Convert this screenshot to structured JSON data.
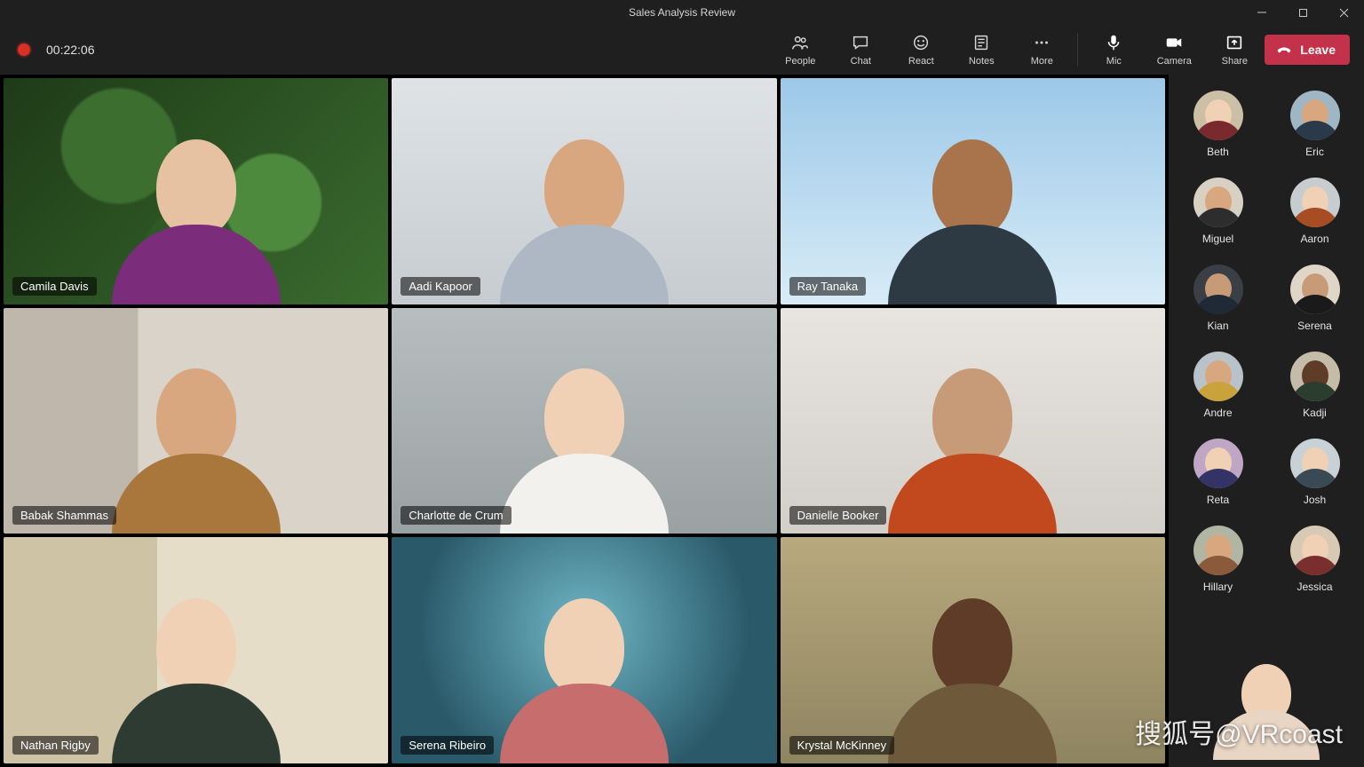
{
  "window": {
    "title": "Sales Analysis Review"
  },
  "recording": {
    "time": "00:22:06"
  },
  "toolbar": {
    "people": "People",
    "chat": "Chat",
    "react": "React",
    "notes": "Notes",
    "more": "More",
    "mic": "Mic",
    "camera": "Camera",
    "share": "Share",
    "leave": "Leave"
  },
  "participants_main": [
    {
      "name": "Camila Davis",
      "env": "env-leaves",
      "skin": "skin-1",
      "shirt": "#7b2c7a"
    },
    {
      "name": "Aadi Kapoor",
      "env": "env-office1",
      "skin": "skin-2",
      "shirt": "#aeb7c4"
    },
    {
      "name": "Ray Tanaka",
      "env": "env-sky",
      "skin": "skin-3",
      "shirt": "#2d3a44"
    },
    {
      "name": "Babak Shammas",
      "env": "env-office2",
      "skin": "skin-2",
      "shirt": "#a9773c"
    },
    {
      "name": "Charlotte de Crum",
      "env": "env-grey",
      "skin": "skin-6",
      "shirt": "#f3f1ed"
    },
    {
      "name": "Danielle Booker",
      "env": "env-plain",
      "skin": "skin-4",
      "shirt": "#c2491e"
    },
    {
      "name": "Nathan Rigby",
      "env": "env-office3",
      "skin": "skin-6",
      "shirt": "#2e3b33"
    },
    {
      "name": "Serena Ribeiro",
      "env": "env-tech",
      "skin": "skin-6",
      "shirt": "#c76d6e"
    },
    {
      "name": "Krystal McKinney",
      "env": "env-plants",
      "skin": "skin-5",
      "shirt": "#6e5a3a"
    }
  ],
  "participants_side": [
    {
      "name": "Beth",
      "bg": "#cbbfa5",
      "skin": "skin-6",
      "shirt": "#7a2a2d"
    },
    {
      "name": "Eric",
      "bg": "#9fb7c4",
      "skin": "skin-2",
      "shirt": "#2a3a4a"
    },
    {
      "name": "Miguel",
      "bg": "#d7d0c3",
      "skin": "skin-2",
      "shirt": "#2d2d2d"
    },
    {
      "name": "Aaron",
      "bg": "#c7cccf",
      "skin": "skin-6",
      "shirt": "#a84c24"
    },
    {
      "name": "Kian",
      "bg": "#3a3f46",
      "skin": "skin-4",
      "shirt": "#1f2a36"
    },
    {
      "name": "Serena",
      "bg": "#e0d6c8",
      "skin": "skin-4",
      "shirt": "#1a1a1a"
    },
    {
      "name": "Andre",
      "bg": "#b9c2c8",
      "skin": "skin-2",
      "shirt": "#c9a23b"
    },
    {
      "name": "Kadji",
      "bg": "#c4bca9",
      "skin": "skin-5",
      "shirt": "#2b3d2f"
    },
    {
      "name": "Reta",
      "bg": "#bfa6c4",
      "skin": "skin-6",
      "shirt": "#333366"
    },
    {
      "name": "Josh",
      "bg": "#c8d2d6",
      "skin": "skin-6",
      "shirt": "#3a4a55"
    },
    {
      "name": "Hillary",
      "bg": "#b0b6a3",
      "skin": "skin-2",
      "shirt": "#8a5a3a"
    },
    {
      "name": "Jessica",
      "bg": "#d8c9b4",
      "skin": "skin-6",
      "shirt": "#7a2e2e"
    }
  ],
  "self_view": {
    "env": "env-self",
    "skin": "skin-6",
    "shirt": "#e8d5c3"
  },
  "watermark": "搜狐号@VRcoast"
}
